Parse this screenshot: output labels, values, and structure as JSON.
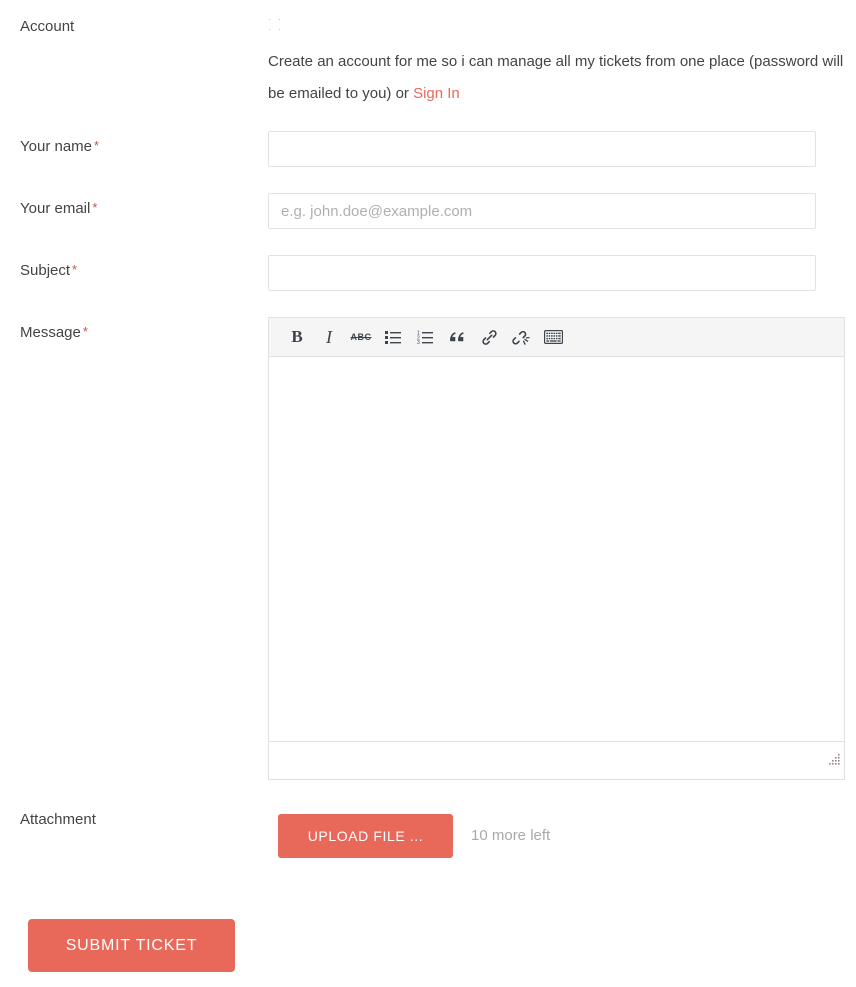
{
  "colors": {
    "accent": "#e8685a",
    "label_text": "#444444",
    "required_star": "#c0564a",
    "placeholder": "#b0b0b0",
    "hint_text": "#a9a9a9",
    "input_border": "#e2e2e2",
    "toolbar_bg": "#f5f5f5"
  },
  "account": {
    "label": "Account",
    "checkbox_checked": false,
    "description_prefix": "Create an account for me so i can manage all my tickets from one place (password will be emailed to you) or ",
    "signin_link": "Sign In"
  },
  "fields": {
    "name": {
      "label": "Your name",
      "required_marker": "*",
      "value": "",
      "placeholder": ""
    },
    "email": {
      "label": "Your email",
      "required_marker": "*",
      "value": "",
      "placeholder": "e.g. john.doe@example.com"
    },
    "subject": {
      "label": "Subject",
      "required_marker": "*",
      "value": "",
      "placeholder": ""
    },
    "message": {
      "label": "Message",
      "required_marker": "*",
      "value": ""
    }
  },
  "editor": {
    "toolbar": [
      {
        "name": "bold",
        "glyph": "B",
        "title": "Bold"
      },
      {
        "name": "italic",
        "glyph": "I",
        "title": "Italic"
      },
      {
        "name": "strikethrough",
        "glyph": "ABC",
        "title": "Strikethrough"
      },
      {
        "name": "unordered-list",
        "glyph": "",
        "title": "Bulleted list"
      },
      {
        "name": "ordered-list",
        "glyph": "",
        "title": "Numbered list"
      },
      {
        "name": "blockquote",
        "glyph": "“",
        "title": "Blockquote"
      },
      {
        "name": "link",
        "glyph": "",
        "title": "Insert link"
      },
      {
        "name": "unlink",
        "glyph": "",
        "title": "Remove link"
      },
      {
        "name": "toggle-toolbar",
        "glyph": "",
        "title": "Toggle toolbar"
      }
    ]
  },
  "attachment": {
    "label": "Attachment",
    "upload_button": "UPLOAD FILE ...",
    "hint": "10 more left"
  },
  "submit": {
    "label": "SUBMIT TICKET"
  }
}
